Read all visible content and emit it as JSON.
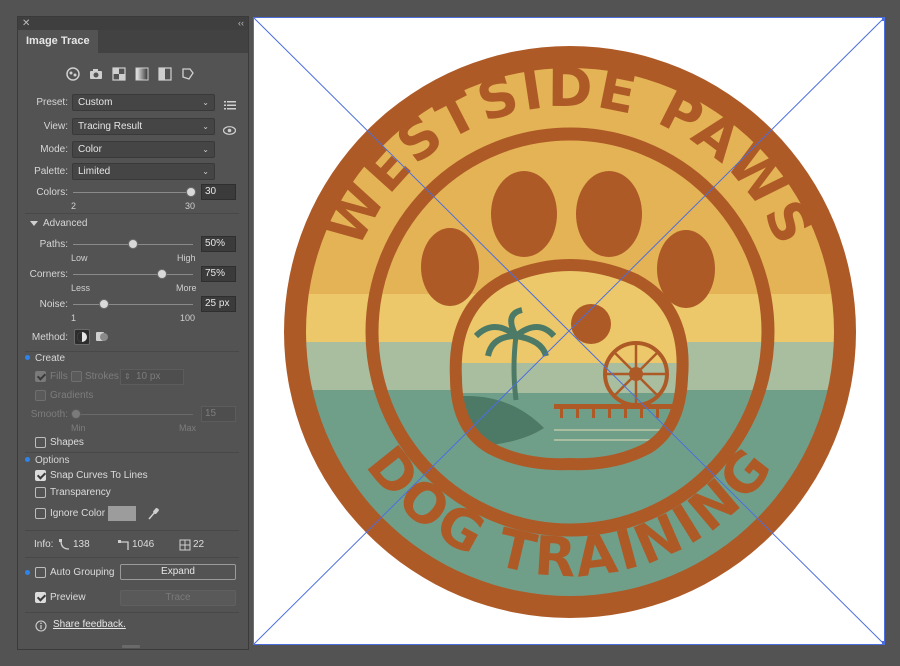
{
  "panel": {
    "tab": "Image Trace",
    "close_glyph": "✕",
    "collapse_glyph": "‹‹",
    "preset": {
      "label": "Preset:",
      "value": "Custom"
    },
    "view": {
      "label": "View:",
      "value": "Tracing Result"
    },
    "mode": {
      "label": "Mode:",
      "value": "Color"
    },
    "palette": {
      "label": "Palette:",
      "value": "Limited"
    },
    "colors": {
      "label": "Colors:",
      "value": "30",
      "min": "2",
      "max": "30",
      "level": 1.0
    },
    "advanced": "Advanced",
    "paths": {
      "label": "Paths:",
      "value": "50%",
      "min": "Low",
      "max": "High",
      "level": 0.5
    },
    "corners": {
      "label": "Corners:",
      "value": "75%",
      "min": "Less",
      "max": "More",
      "level": 0.75
    },
    "noise": {
      "label": "Noise:",
      "value": "25 px",
      "min": "1",
      "max": "100",
      "level": 0.25
    },
    "method": {
      "label": "Method:"
    },
    "create": {
      "title": "Create",
      "fills": "Fills",
      "strokes": "Strokes",
      "stroke_value": "10 px",
      "gradients": "Gradients",
      "smooth_label": "Smooth:",
      "smooth_value": "15",
      "smooth_min": "Min",
      "smooth_max": "Max",
      "shapes": "Shapes"
    },
    "options": {
      "title": "Options",
      "snap": "Snap Curves To Lines",
      "transparency": "Transparency",
      "ignore_color": "Ignore Color"
    },
    "info": {
      "label": "Info:",
      "paths": "138",
      "anchors": "1046",
      "colors": "22"
    },
    "auto_grouping": "Auto Grouping",
    "expand": "Expand",
    "preview": "Preview",
    "trace": "Trace",
    "feedback": "Share feedback."
  },
  "artwork": {
    "top_text": "WESTSIDE PAWS",
    "bottom_text": "DOG TRAINING",
    "colors": {
      "rust": "#ae5a27",
      "gold": "#e4b356",
      "light_gold": "#ecc86a",
      "sage": "#a9bd9f",
      "teal": "#709f89",
      "selection": "#4c6ede"
    }
  }
}
